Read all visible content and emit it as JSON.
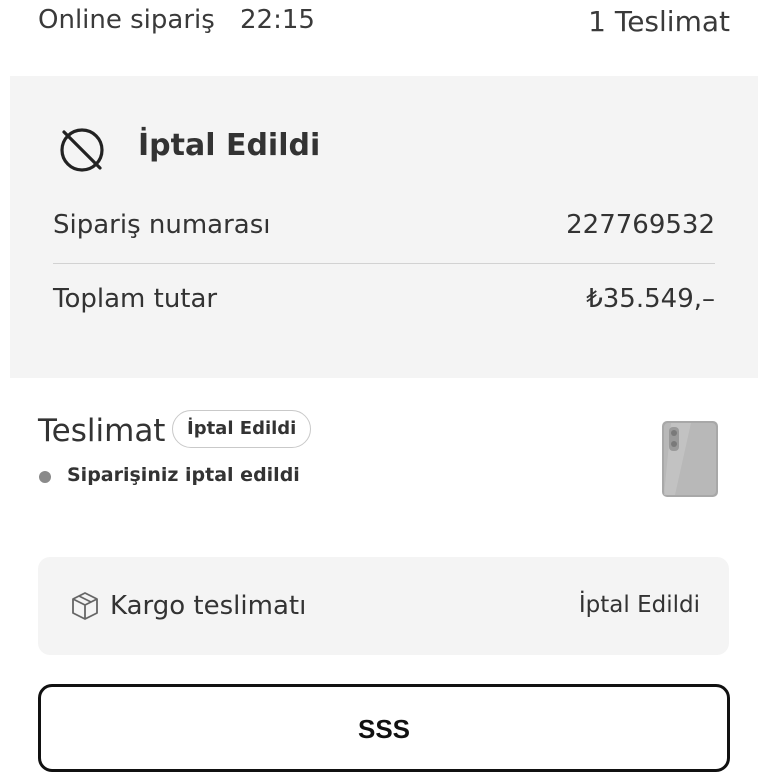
{
  "header": {
    "order_type": "Online sipariş",
    "time": "22:15",
    "delivery_count": "1 Teslimat"
  },
  "summary": {
    "status_icon": "cancelled-circle-icon",
    "status": "İptal Edildi",
    "order_number_label": "Sipariş numarası",
    "order_number": "227769532",
    "total_label": "Toplam tutar",
    "total": "₺35.549,–"
  },
  "delivery": {
    "title": "Teslimat",
    "badge": "İptal Edildi",
    "status_message": "Siparişiniz iptal edildi",
    "product_image": "phone-thumbnail"
  },
  "cargo": {
    "icon": "package-box-icon",
    "label": "Kargo teslimatı",
    "status": "İptal Edildi"
  },
  "faq_button": {
    "label": "SSS"
  },
  "colors": {
    "panel_bg": "#f4f4f4",
    "text": "#333333",
    "dot": "#8a8a8a",
    "button_border": "#111111"
  }
}
